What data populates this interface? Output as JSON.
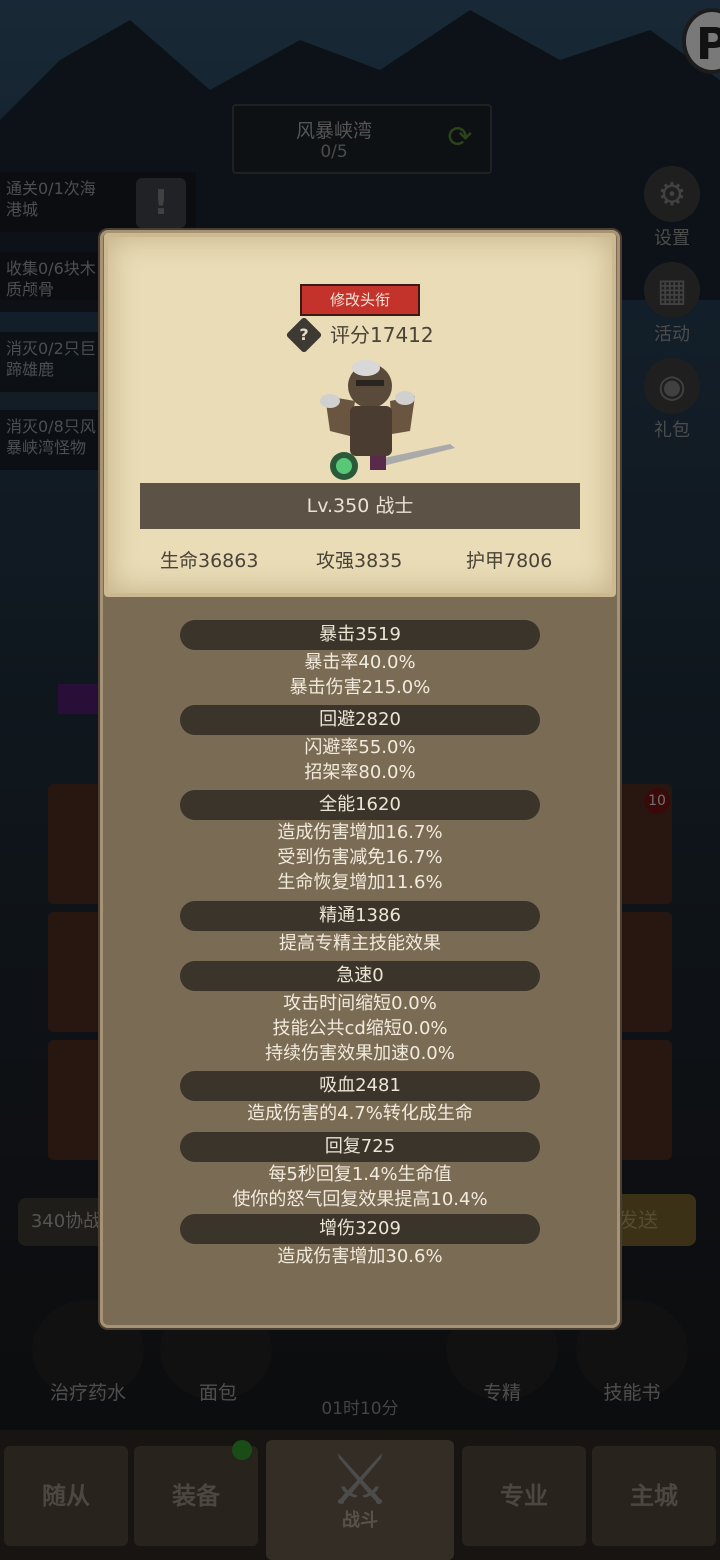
{
  "hud": {
    "stage_name": "风暴峡湾",
    "stage_progress": "0/5",
    "quests": [
      "通关0/1次海\n港城",
      "收集0/6块木\n质颅骨",
      "消灭0/2只巨\n蹄雄鹿",
      "消灭0/8只风\n暴峡湾怪物"
    ],
    "side_buttons": [
      "设置",
      "活动",
      "礼包"
    ],
    "side_icons": [
      "gear-icon",
      "calendar-icon",
      "gift-icon"
    ],
    "notif_count": "10",
    "share_left": "340协战",
    "share_right": "发送",
    "bottom_items": [
      "治疗药水",
      "面包",
      "专精",
      "技能书"
    ],
    "timer": "01时10分"
  },
  "nav": {
    "tabs": [
      "随从",
      "装备",
      "战斗",
      "专业",
      "主城"
    ]
  },
  "panel": {
    "title_button": "修改头衔",
    "score": "评分17412",
    "level_class": "Lv.350 战士",
    "hp": "生命36863",
    "attack": "攻强3835",
    "armor": "护甲7806",
    "attributes": [
      {
        "name": "暴击3519",
        "details": [
          "暴击率40.0%",
          "暴击伤害215.0%"
        ]
      },
      {
        "name": "回避2820",
        "details": [
          "闪避率55.0%",
          "招架率80.0%"
        ]
      },
      {
        "name": "全能1620",
        "details": [
          "造成伤害增加16.7%",
          "受到伤害减免16.7%",
          "生命恢复增加11.6%"
        ]
      },
      {
        "name": "精通1386",
        "details": [
          "提高专精主技能效果"
        ]
      },
      {
        "name": "急速0",
        "details": [
          "攻击时间缩短0.0%",
          "技能公共cd缩短0.0%",
          "持续伤害效果加速0.0%"
        ]
      },
      {
        "name": "吸血2481",
        "details": [
          "造成伤害的4.7%转化成生命"
        ]
      },
      {
        "name": "回复725",
        "details": [
          "每5秒回复1.4%生命值",
          "使你的怒气回复效果提高10.4%"
        ]
      },
      {
        "name": "增伤3209",
        "details": [
          "造成伤害增加30.6%"
        ]
      }
    ]
  },
  "colors": {
    "title_button": "#c4322c",
    "panel": "#7a6b55",
    "card": "#e9dcb6",
    "attr_pill": "#3b342b"
  }
}
